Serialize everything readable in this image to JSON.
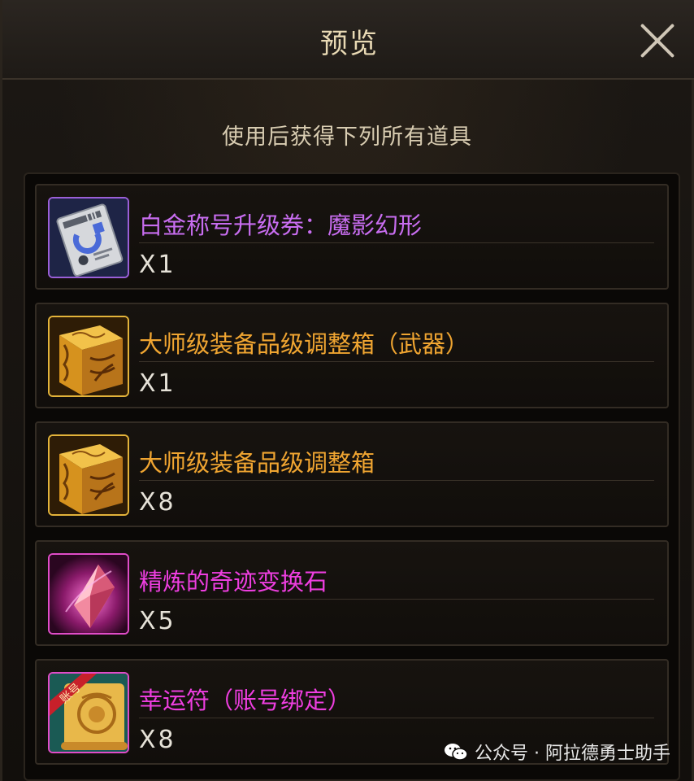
{
  "dialog": {
    "title": "预览",
    "subtitle": "使用后获得下列所有道具"
  },
  "items": [
    {
      "name": "白金称号升级券：魔影幻形",
      "quantity": "X1",
      "name_color": "#c86df0",
      "icon": "ticket-icon",
      "frame_color": "#9a5fd8"
    },
    {
      "name": "大师级装备品级调整箱（武器）",
      "quantity": "X1",
      "name_color": "#f0a531",
      "icon": "golden-box-icon",
      "frame_color": "#e3b33a"
    },
    {
      "name": "大师级装备品级调整箱",
      "quantity": "X8",
      "name_color": "#f0a531",
      "icon": "golden-box-icon",
      "frame_color": "#e3b33a"
    },
    {
      "name": "精炼的奇迹变换石",
      "quantity": "X5",
      "name_color": "#ee3ee0",
      "icon": "crystal-icon",
      "frame_color": "#e04cc8"
    },
    {
      "name": "幸运符（账号绑定）",
      "quantity": "X8",
      "name_color": "#ee3ee0",
      "icon": "scroll-icon",
      "frame_color": "#e04cc8",
      "badge": "账号"
    }
  ],
  "watermark": {
    "text": "公众号 · 阿拉德勇士助手"
  }
}
